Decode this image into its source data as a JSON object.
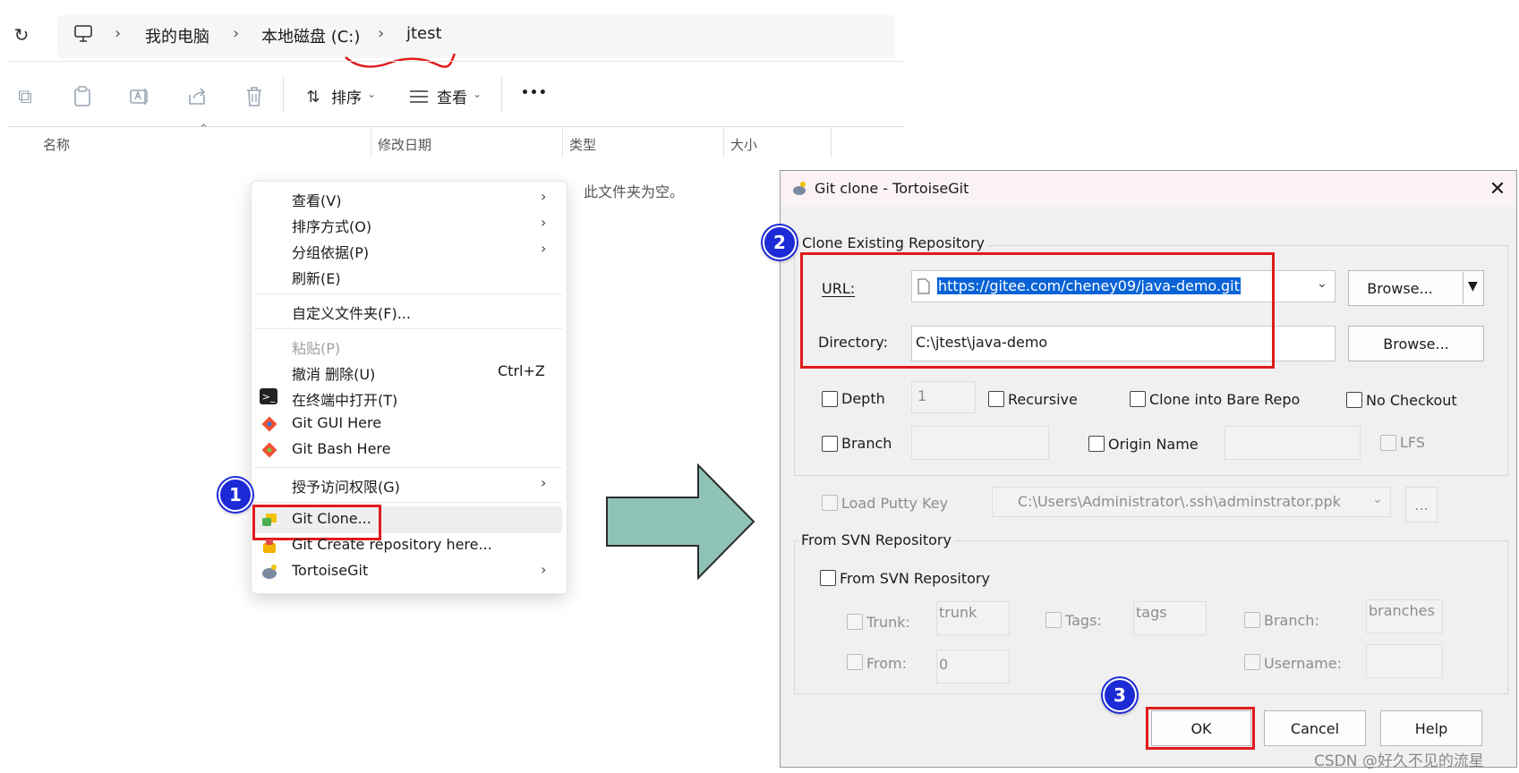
{
  "explorer": {
    "breadcrumb": [
      "我的电脑",
      "本地磁盘 (C:)",
      "jtest"
    ],
    "toolbar": {
      "sort_label": "排序",
      "view_label": "查看",
      "more_label": "•••"
    },
    "columns": [
      "名称",
      "修改日期",
      "类型",
      "大小"
    ],
    "empty_text": "此文件夹为空。"
  },
  "context_menu": {
    "items": [
      {
        "label": "查看(V)"
      },
      {
        "label": "排序方式(O)"
      },
      {
        "label": "分组依据(P)"
      },
      {
        "label": "刷新(E)"
      },
      {
        "label": "自定义文件夹(F)..."
      },
      {
        "label": "粘贴(P)"
      },
      {
        "label": "撤消 删除(U)",
        "shortcut": "Ctrl+Z"
      },
      {
        "label": "在终端中打开(T)"
      },
      {
        "label": "Git GUI Here"
      },
      {
        "label": "Git Bash Here"
      },
      {
        "label": "授予访问权限(G)"
      },
      {
        "label": "Git Clone..."
      },
      {
        "label": "Git Create repository here..."
      },
      {
        "label": "TortoiseGit"
      }
    ]
  },
  "annotations": {
    "badge1": "1",
    "badge2": "2",
    "badge3": "3"
  },
  "dialog": {
    "title": "Git clone - TortoiseGit",
    "clone_group": "Clone Existing Repository",
    "url_label": "URL:",
    "url_value": "https://gitee.com/cheney09/java-demo.git",
    "directory_label": "Directory:",
    "directory_value": "C:\\jtest\\java-demo",
    "browse1": "Browse...",
    "browse2": "Browse...",
    "depth_label": "Depth",
    "depth_value": "1",
    "recursive_label": "Recursive",
    "bare_label": "Clone into Bare Repo",
    "nocheckout_label": "No Checkout",
    "branch_label": "Branch",
    "origin_label": "Origin Name",
    "lfs_label": "LFS",
    "putty_label": "Load Putty Key",
    "putty_value": "C:\\Users\\Administrator\\.ssh\\adminstrator.ppk",
    "putty_browse": "...",
    "svn_group": "From SVN Repository",
    "svn_check_label": "From SVN Repository",
    "trunk_label": "Trunk:",
    "trunk_value": "trunk",
    "tags_label": "Tags:",
    "tags_value": "tags",
    "branch2_label": "Branch:",
    "branch2_value": "branches",
    "from_label": "From:",
    "from_value": "0",
    "username_label": "Username:",
    "ok": "OK",
    "cancel": "Cancel",
    "help": "Help"
  },
  "watermark": "CSDN @好久不见的流星",
  "colors": {
    "highlight": "#e01b1b",
    "badge": "#1d2bd6",
    "arrow": "#8fc3b7",
    "selection": "#0a63d6"
  }
}
